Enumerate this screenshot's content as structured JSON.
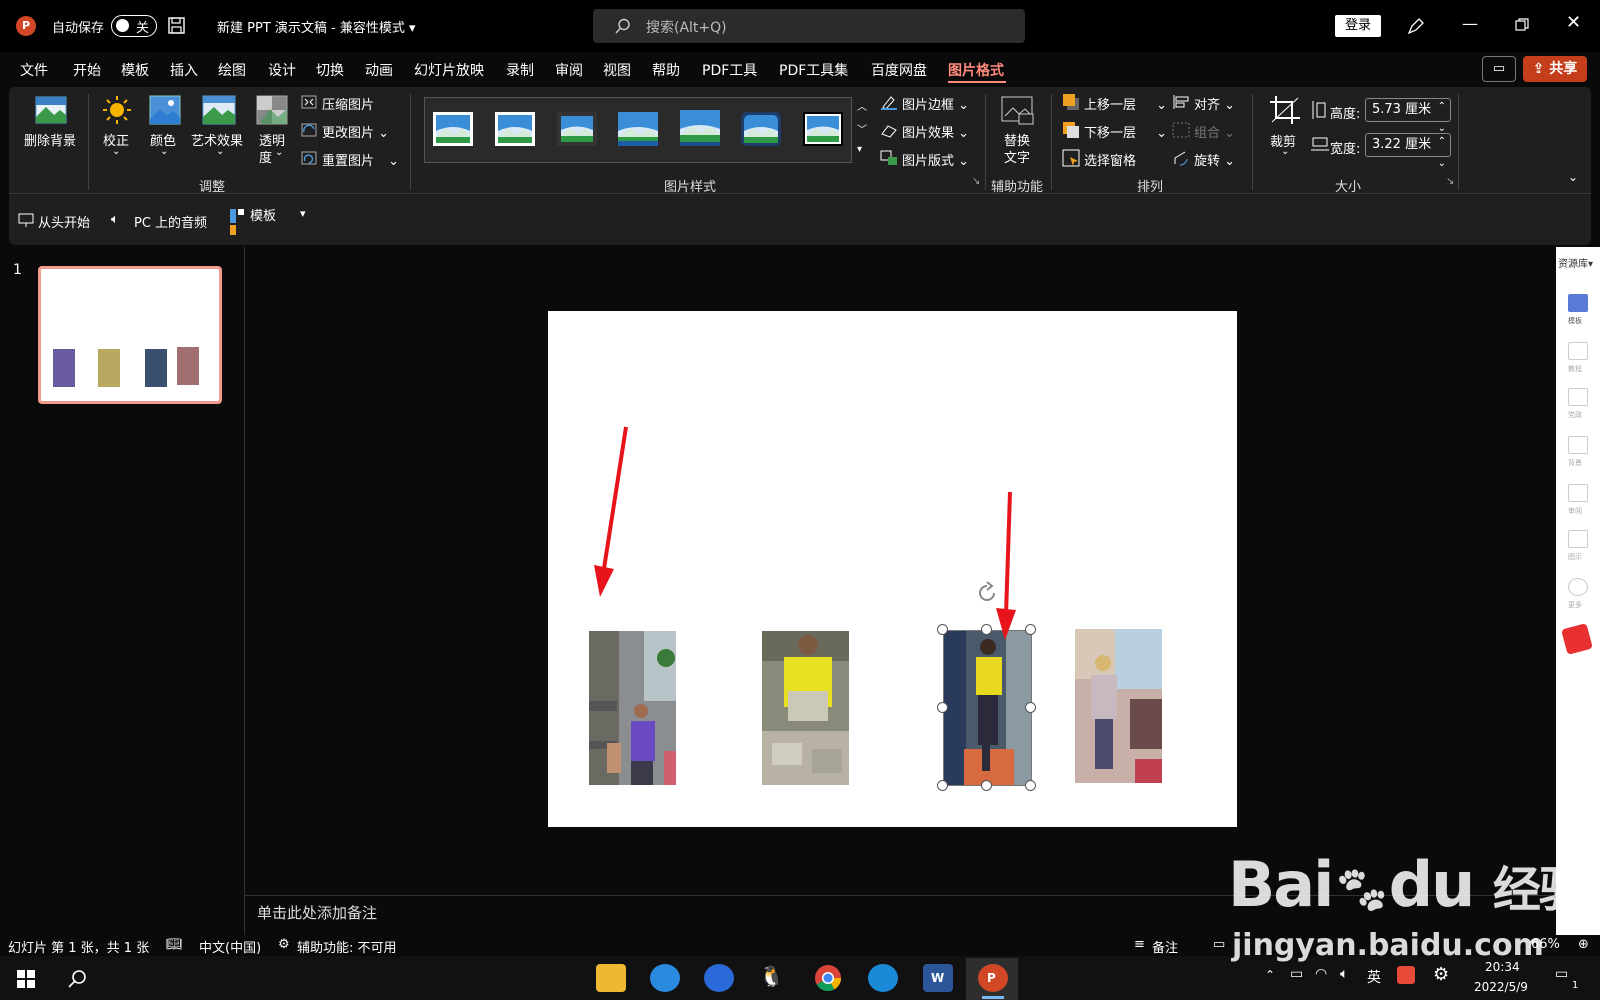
{
  "app": {
    "logo_letter": "P",
    "autosave_label": "自动保存",
    "autosave_state": "关",
    "document_title": "新建 PPT 演示文稿  -  兼容性模式",
    "search_placeholder": "搜索(Alt+Q)",
    "login": "登录"
  },
  "menu": {
    "tabs": [
      "文件",
      "开始",
      "模板",
      "插入",
      "绘图",
      "设计",
      "切换",
      "动画",
      "幻灯片放映",
      "录制",
      "审阅",
      "视图",
      "帮助",
      "PDF工具",
      "PDF工具集",
      "百度网盘",
      "图片格式"
    ],
    "active_tab": "图片格式",
    "share": "共享"
  },
  "ribbon": {
    "adjust": {
      "remove_bg": "删除背景",
      "correct": "校正",
      "color": "颜色",
      "art_effect": "艺术效果",
      "transparency_1": "透明",
      "transparency_2": "度",
      "compress": "压缩图片",
      "change": "更改图片",
      "reset": "重置图片",
      "group_label": "调整"
    },
    "styles": {
      "border": "图片边框",
      "effect": "图片效果",
      "layout": "图片版式",
      "group_label": "图片样式"
    },
    "accessibility": {
      "alt_text_1": "替换",
      "alt_text_2": "文字",
      "group_label": "辅助功能"
    },
    "arrange": {
      "bring_forward": "上移一层",
      "send_backward": "下移一层",
      "selection_pane": "选择窗格",
      "align": "对齐",
      "group": "组合",
      "rotate": "旋转",
      "group_label": "排列"
    },
    "size": {
      "crop": "裁剪",
      "height_label": "高度:",
      "height_value": "5.73 厘米",
      "width_label": "宽度:",
      "width_value": "3.22 厘米",
      "group_label": "大小"
    }
  },
  "quickbar": {
    "from_start": "从头开始",
    "pc_audio": "PC 上的音频",
    "template": "模板"
  },
  "slides_panel": {
    "slide_number": "1"
  },
  "side_rail": {
    "title": "资源库",
    "items": [
      "模板",
      "教程",
      "党政",
      "背景",
      "审阅",
      "图示",
      "更多"
    ]
  },
  "notes": {
    "placeholder": "单击此处添加备注"
  },
  "status_bar": {
    "slide_info": "幻灯片 第 1 张，共 1 张",
    "language": "中文(中国)",
    "accessibility": "辅助功能: 不可用",
    "notes_btn": "备注",
    "zoom": "66%"
  },
  "taskbar": {
    "ime": "英",
    "time": "20:34",
    "date": "2022/5/9",
    "notification_count": "1"
  },
  "watermark": {
    "brand": "Bai",
    "brand2": "du",
    "cn": "经验",
    "url": "jingyan.baidu.com"
  },
  "colors": {
    "accent": "#ff8a7a",
    "share_bg": "#c43e1c",
    "arrow": "#e8141c"
  }
}
